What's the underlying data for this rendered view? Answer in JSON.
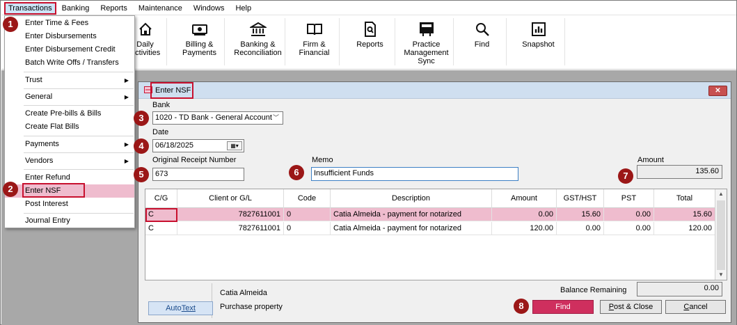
{
  "menubar": {
    "items": [
      "Transactions",
      "Banking",
      "Reports",
      "Maintenance",
      "Windows",
      "Help"
    ]
  },
  "toolbar": {
    "buttons": [
      {
        "label": "Daily\nActivities",
        "icon": "home-icon"
      },
      {
        "label": "Billing &\nPayments",
        "icon": "money-icon"
      },
      {
        "label": "Banking &\nReconciliation",
        "icon": "bank-icon"
      },
      {
        "label": "Firm &\nFinancial",
        "icon": "book-icon"
      },
      {
        "label": "Reports",
        "icon": "report-icon"
      },
      {
        "label": "Practice\nManagement\nSync",
        "icon": "sync-icon"
      },
      {
        "label": "Find",
        "icon": "search-icon"
      },
      {
        "label": "Snapshot",
        "icon": "chart-icon"
      }
    ]
  },
  "menu": {
    "items": [
      "Enter Time & Fees",
      "Enter Disbursements",
      "Enter Disbursement Credit",
      "Batch Write Offs / Transfers",
      "Trust",
      "General",
      "Create Pre-bills & Bills",
      "Create Flat Bills",
      "Payments",
      "Vendors",
      "Enter Refund",
      "Enter NSF",
      "Post Interest",
      "Journal Entry"
    ]
  },
  "badges": [
    "1",
    "2",
    "3",
    "4",
    "5",
    "6",
    "7",
    "8"
  ],
  "dialog": {
    "title": "Enter NSF",
    "close": "✕",
    "bank_label": "Bank",
    "bank_value": "1020 - TD Bank - General Account",
    "date_label": "Date",
    "date_value": "06/18/2025",
    "receipt_label": "Original Receipt Number",
    "receipt_value": "673",
    "memo_label": "Memo",
    "memo_value": "Insufficient Funds",
    "amount_label": "Amount",
    "amount_value": "135.60",
    "grid": {
      "headers": [
        "C/G",
        "Client or G/L",
        "Code",
        "Description",
        "Amount",
        "GST/HST",
        "PST",
        "Total"
      ],
      "rows": [
        [
          "C",
          "7827611001",
          "0",
          "Catia Almeida - payment for notarized",
          "0.00",
          "15.60",
          "0.00",
          "15.60"
        ],
        [
          "C",
          "7827611001",
          "0",
          "Catia Almeida - payment for notarized",
          "120.00",
          "0.00",
          "0.00",
          "120.00"
        ]
      ]
    },
    "client_name": "Catia Almeida",
    "client_matter": "Purchase property",
    "balance_label": "Balance Remaining",
    "balance_value": "0.00",
    "autotext_prefix": "Auto",
    "autotext_suffix": "Text",
    "find_label": "Find",
    "post_close_prefix": "P",
    "post_close_suffix": "ost & Close",
    "cancel_prefix": "C",
    "cancel_suffix": "ancel"
  },
  "colors": {
    "badge": "#9b1717",
    "highlight_border": "#c8102e",
    "selection": "#efbcce",
    "find_button": "#cf2f5e"
  }
}
